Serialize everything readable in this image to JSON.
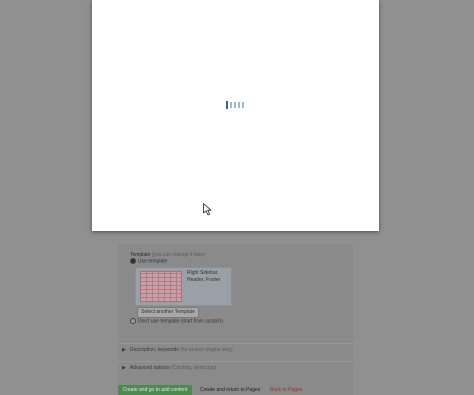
{
  "form": {
    "template_label": "Template",
    "template_hint": "(you can change it later)",
    "use_template_label": "Use template",
    "template_name": "Right Sidebar, Header, Footer",
    "select_template_label": "Select another Template",
    "no_template_label": "Don't use template (start from scratch)"
  },
  "sections": {
    "description_label": "Description, keywords",
    "description_hint": "(for search engine only)",
    "advanced_label": "Advanced options",
    "advanced_hint": "(Caching, dead ago)"
  },
  "actions": {
    "create_edit_label": "Create and go to add content",
    "create_return_label": "Create and return to Pages",
    "back_label": "Back to Pages"
  },
  "loading": {
    "icon": "loading-spinner-icon"
  },
  "colors": {
    "overlay": "#909090",
    "primary_button": "#4e8a4e",
    "spinner_active": "#2e63a8",
    "spinner_inactive": "#9cb8d8",
    "link": "#a0302a"
  }
}
